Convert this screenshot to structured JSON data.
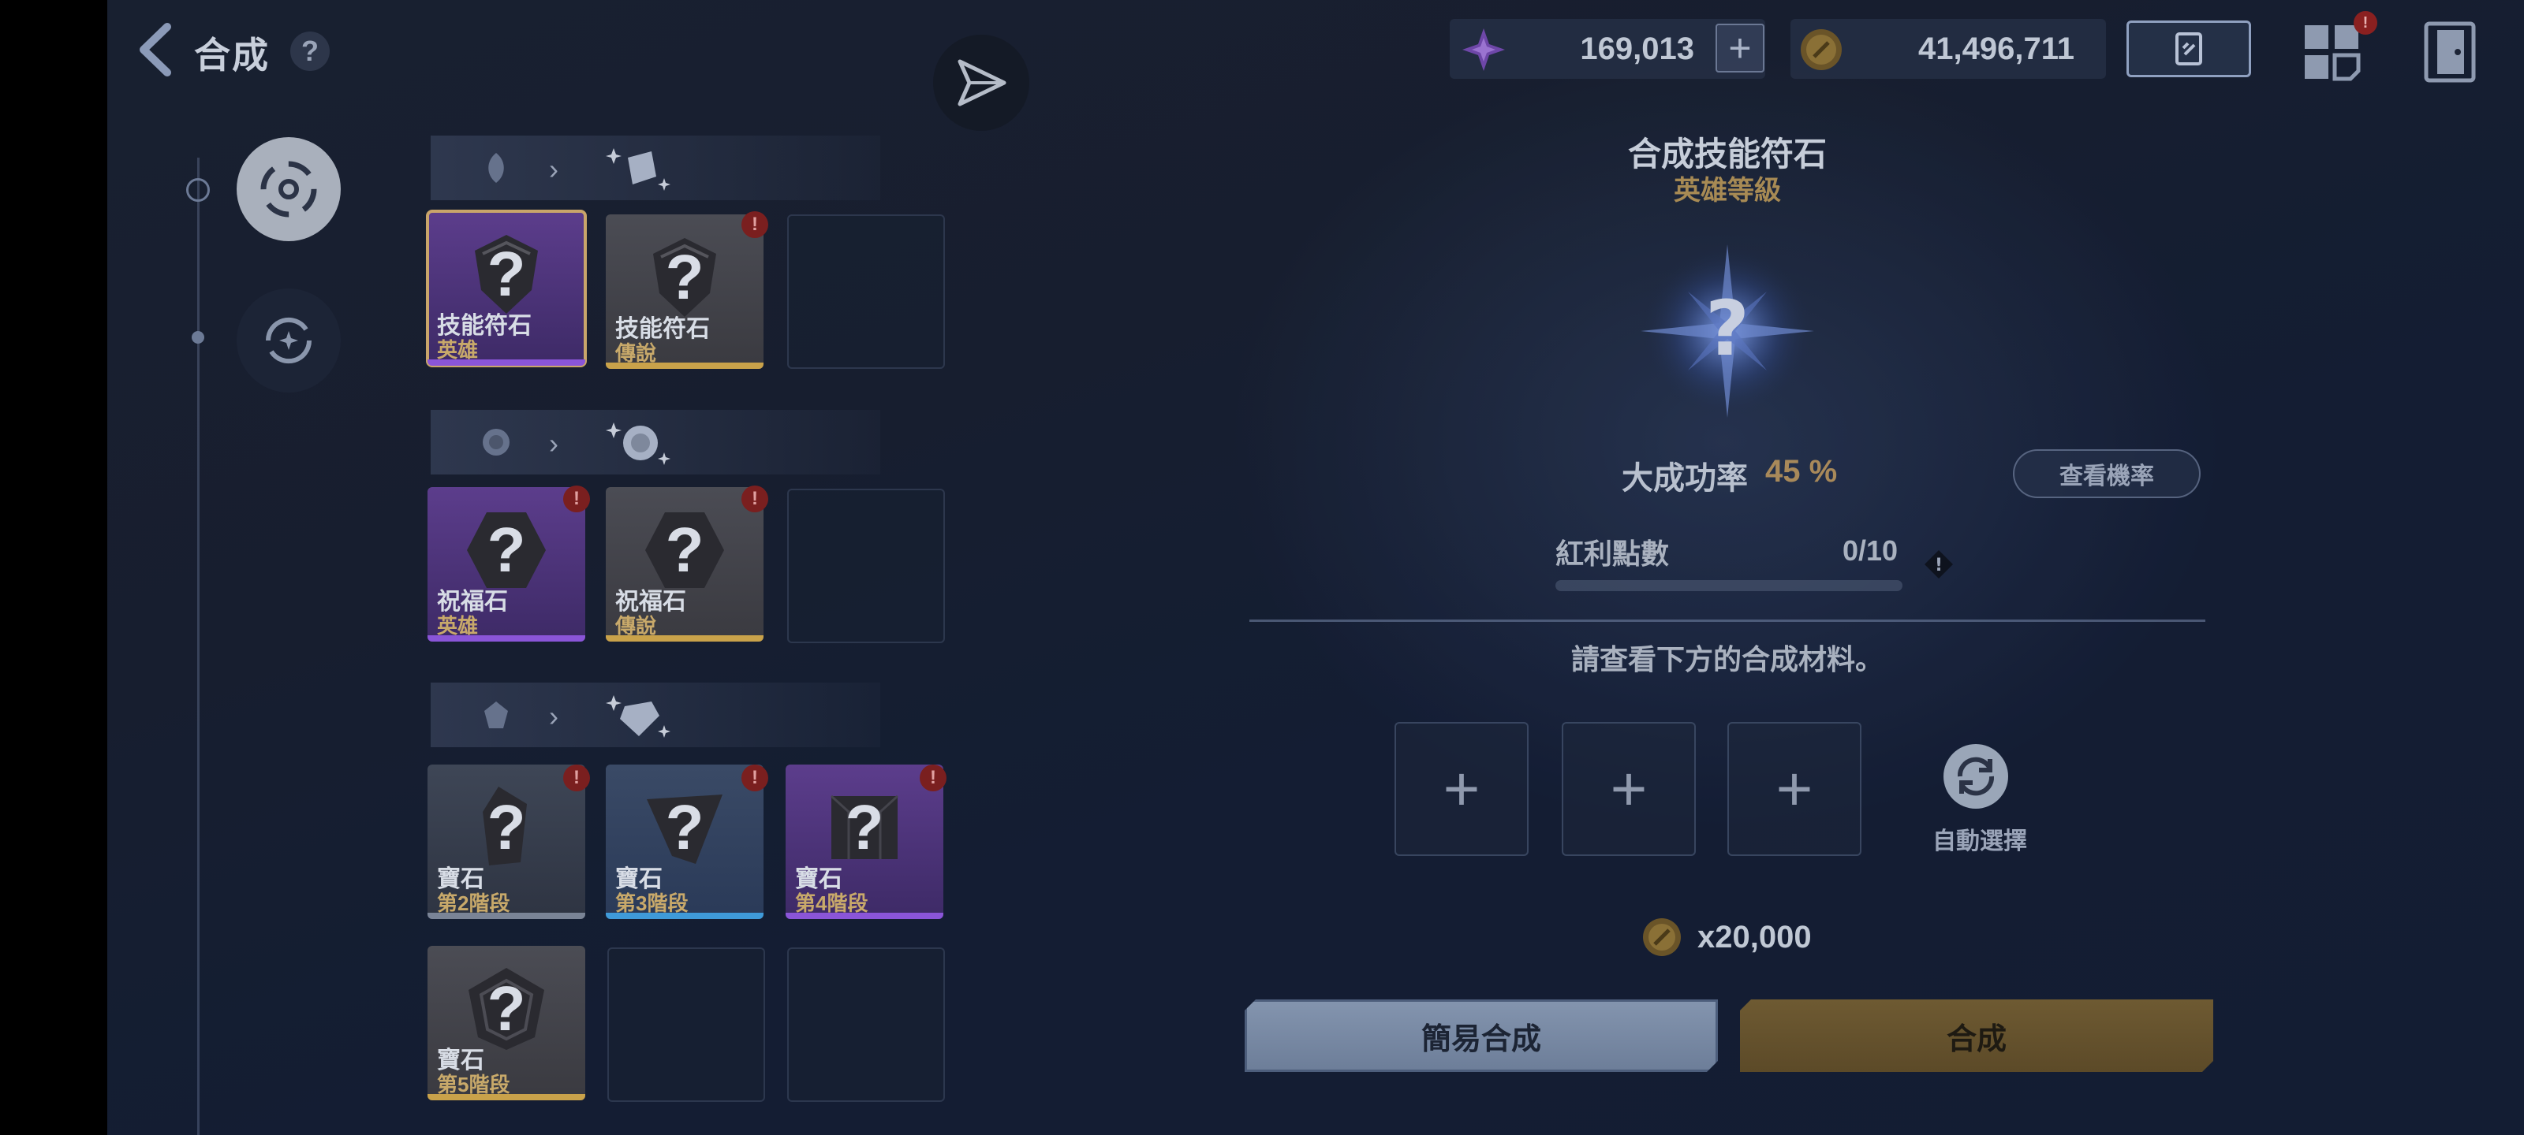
{
  "header": {
    "title": "合成",
    "help_label": "?",
    "gems_amount": "169,013",
    "gems_plus": "+",
    "gold_amount": "41,496,711",
    "menu_badge": "!"
  },
  "sidebar": {
    "tabs": [
      {
        "name": "synthesis-tab",
        "icon": "swirl-icon",
        "active": true
      },
      {
        "name": "refresh-tab",
        "icon": "refresh-sparkle-icon",
        "active": false
      }
    ]
  },
  "categories": [
    {
      "header": {
        "from_icon": "leaf-rune-icon",
        "to_icon": "rune-sparkle-icon"
      },
      "items": [
        {
          "name": "技能符石",
          "grade": "英雄",
          "color": "purple",
          "alert": false,
          "selected": true
        },
        {
          "name": "技能符石",
          "grade": "傳說",
          "color": "gold",
          "alert": true,
          "selected": false
        },
        {
          "empty": true
        }
      ]
    },
    {
      "header": {
        "from_icon": "orb-icon",
        "to_icon": "orb-sparkle-icon"
      },
      "items": [
        {
          "name": "祝福石",
          "grade": "英雄",
          "color": "purple",
          "alert": true
        },
        {
          "name": "祝福石",
          "grade": "傳說",
          "color": "gold",
          "alert": true
        },
        {
          "empty": true
        }
      ]
    },
    {
      "header": {
        "from_icon": "gem-icon",
        "to_icon": "diamond-sparkle-icon"
      },
      "items": [
        {
          "name": "寶石",
          "grade": "第2階段",
          "color": "grey",
          "alert": true
        },
        {
          "name": "寶石",
          "grade": "第3階段",
          "color": "blue",
          "alert": true
        },
        {
          "name": "寶石",
          "grade": "第4階段",
          "color": "purple",
          "alert": true
        },
        {
          "name": "寶石",
          "grade": "第5階段",
          "color": "gold",
          "alert": false
        },
        {
          "empty": true
        },
        {
          "empty": true
        }
      ]
    }
  ],
  "panel": {
    "title": "合成技能符石",
    "grade": "英雄等級",
    "rate_label": "大成功率",
    "rate_value": "45 %",
    "view_rate_label": "查看機率",
    "bonus_label": "紅利點數",
    "bonus_value": "0/10",
    "bonus_progress": 0,
    "instruction": "請查看下方的合成材料。",
    "slot_label": "+",
    "auto_select_label": "自動選擇",
    "cost": "x20,000",
    "easy_button": "簡易合成",
    "synth_button": "合成"
  },
  "colors": {
    "purple_bar": "#8a55d8",
    "gold_bar": "#c9a24a",
    "blue_bar": "#3f9ad8",
    "grey_bar": "#7a8496",
    "accent_gold": "#a8895a"
  }
}
